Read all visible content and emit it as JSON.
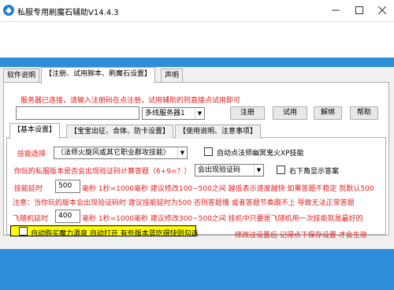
{
  "window": {
    "title": "私服专用刷魔石辅助V14.4.3"
  },
  "tabs_main": [
    {
      "label": "软件说明"
    },
    {
      "label": "【注册、试用脚本、刷魔石设置】"
    },
    {
      "label": "声明"
    }
  ],
  "server_msg": "服务器已连接，请输入注册码在点注册，试用辅助的则直接点试用即可",
  "reg": {
    "code_value": "",
    "server_select": "多线服务器1",
    "register": "注册",
    "trial": "试用",
    "unbind": "解绑",
    "help": "帮助"
  },
  "tabs_sub": [
    {
      "label": "【基本设置】"
    },
    {
      "label": "【宝宝出征、合体、防卡设置】"
    },
    {
      "label": "【使用说明、注意事项】"
    }
  ],
  "basic": {
    "skill_label": "技能选择",
    "skill_value": "（法师火旋风或其它职业群攻技能）",
    "auto_ghost": "自动点法师幽冥鬼火XP技能",
    "captcha_q": "你玩的私服版本是否会出现验证码计算答题（6+9=？）",
    "captcha_value": "会出现验证码",
    "right_bottom": "右下角显示答案",
    "delay_label": "技能延时",
    "delay_value": "500",
    "delay_desc": "毫秒 1秒=1000毫秒 建议修改100~500之间  越低表示速度越快 如果答题不稳定 就默认500",
    "note": "注意：当你玩的版本会出现验证码时 建议技能延时为500 否则答题慢 或者答题节奏跟不上  导致无法正常答题",
    "fly_label": "飞随机延时",
    "fly_value": "400",
    "fly_desc": "毫秒 1秒=1000毫秒 建议修改300~500之间 挂机中只要是飞随机用一次技能就是最好的",
    "auto_buy": "自动购买魔力源泉 自动打开 有些版本蓝吃得快则勾选",
    "save_note": "修改过设置后 记得点下保存设置 才会生效"
  },
  "colors": {
    "band": "#2e8edb",
    "accent_red": "#e21c1c",
    "highlight": "#ffff00"
  }
}
